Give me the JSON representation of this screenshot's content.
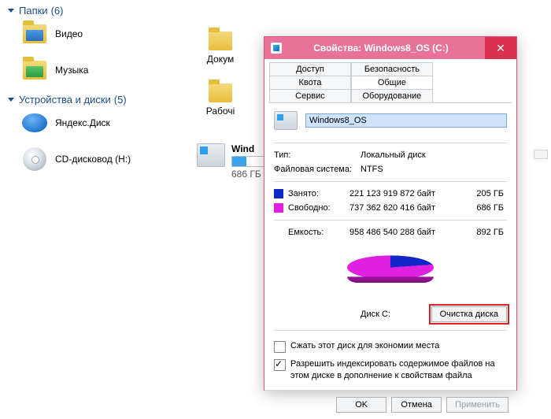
{
  "groups": {
    "folders": {
      "title": "Папки",
      "count": "(6)"
    },
    "devices": {
      "title": "Устройства и диски",
      "count": "(5)"
    }
  },
  "left_items": {
    "video": "Видео",
    "music": "Музыка",
    "yandex": "Яндекс.Диск",
    "cdrom": "CD-дисковод (H:)"
  },
  "right_items": {
    "docs": "Докум",
    "desk": "Рабочі",
    "drive_name": "Wind",
    "drive_free": "686 ГБ"
  },
  "dialog": {
    "title": "Свойства: Windows8_OS (C:)",
    "tabs": {
      "access": "Доступ",
      "security": "Безопасность",
      "quota": "Квота",
      "general": "Общие",
      "service": "Сервис",
      "hardware": "Оборудование"
    },
    "name_value": "Windows8_OS",
    "type_k": "Тип:",
    "type_v": "Локальный диск",
    "fs_k": "Файловая система:",
    "fs_v": "NTFS",
    "used_k": "Занято:",
    "used_bytes": "221 123 919 872 байт",
    "used_gb": "205 ГБ",
    "free_k": "Свободно:",
    "free_bytes": "737 362 620 416 байт",
    "free_gb": "686 ГБ",
    "cap_k": "Емкость:",
    "cap_bytes": "958 486 540 288 байт",
    "cap_gb": "892 ГБ",
    "disk_label": "Диск C:",
    "cleanup_btn": "Очистка диска",
    "compress": "Сжать этот диск для экономии места",
    "index": "Разрешить индексировать содержимое файлов на этом диске в дополнение к свойствам файла",
    "ok": "OK",
    "cancel": "Отмена",
    "apply": "Применить"
  },
  "chart_data": {
    "type": "pie",
    "title": "Диск C:",
    "series": [
      {
        "name": "Занято",
        "value_bytes": 221123919872,
        "value_gb": 205,
        "color": "#1028c8"
      },
      {
        "name": "Свободно",
        "value_bytes": 737362620416,
        "value_gb": 686,
        "color": "#e020e0"
      }
    ],
    "total_bytes": 958486540288,
    "total_gb": 892
  }
}
